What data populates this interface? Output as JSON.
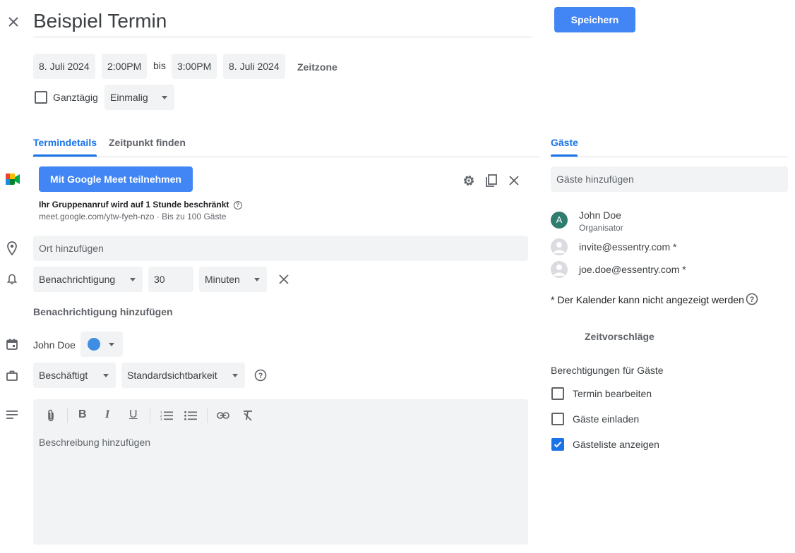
{
  "header": {
    "title": "Beispiel Termin",
    "save_label": "Speichern"
  },
  "datetime": {
    "start_date": "8. Juli 2024",
    "start_time": "2:00PM",
    "to_label": "bis",
    "end_time": "3:00PM",
    "end_date": "8. Juli 2024",
    "timezone_label": "Zeitzone",
    "allday_label": "Ganztägig",
    "allday_checked": false,
    "recurrence": "Einmalig"
  },
  "tabs": [
    {
      "label": "Termindetails",
      "active": true
    },
    {
      "label": "Zeitpunkt finden",
      "active": false
    }
  ],
  "meet": {
    "button_label": "Mit Google Meet teilnehmen",
    "limit_text": "Ihr Gruppenanruf wird auf 1 Stunde beschränkt",
    "link_text": "meet.google.com/ytw-fyeh-nzo · Bis zu 100 Gäste"
  },
  "location": {
    "placeholder": "Ort hinzufügen"
  },
  "notification": {
    "type": "Benachrichtigung",
    "value": "30",
    "unit": "Minuten",
    "add_label": "Benachrichtigung hinzufügen"
  },
  "calendar": {
    "owner": "John Doe",
    "color": "#4285f4"
  },
  "availability": {
    "status": "Beschäftigt",
    "visibility": "Standardsichtbarkeit"
  },
  "description": {
    "placeholder": "Beschreibung hinzufügen"
  },
  "guests": {
    "tab_label": "Gäste",
    "add_placeholder": "Gäste hinzufügen",
    "list": [
      {
        "name": "John Doe",
        "role": "Organisator",
        "avatar_letter": "A",
        "avatar_color": "#2e7d6e"
      },
      {
        "name": "invite@essentry.com *",
        "role": "",
        "avatar_letter": "",
        "avatar_color": "#dadce0"
      },
      {
        "name": "joe.doe@essentry.com *",
        "role": "",
        "avatar_letter": "",
        "avatar_color": "#dadce0"
      }
    ],
    "calendar_note": "* Der Kalender kann nicht angezeigt werden",
    "suggest_label": "Zeitvorschläge",
    "permissions_title": "Berechtigungen für Gäste",
    "permissions": [
      {
        "label": "Termin bearbeiten",
        "checked": false
      },
      {
        "label": "Gäste einladen",
        "checked": false
      },
      {
        "label": "Gästeliste anzeigen",
        "checked": true
      }
    ]
  },
  "colors": {
    "accent": "#1a73e8",
    "button": "#4285f4",
    "field_bg": "#f1f3f4"
  }
}
